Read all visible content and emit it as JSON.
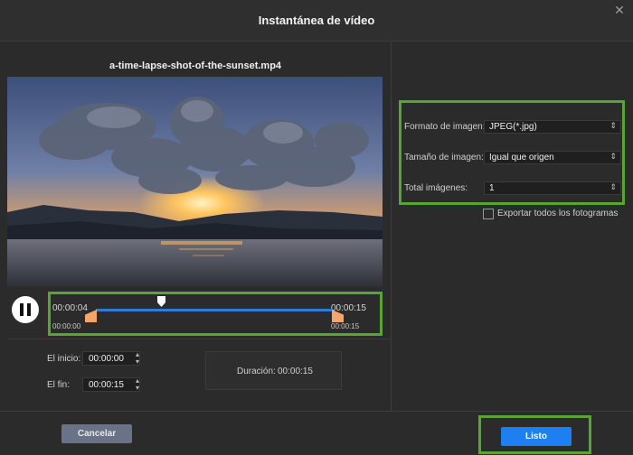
{
  "dialog": {
    "title": "Instantánea de vídeo",
    "close_symbol": "✕"
  },
  "video": {
    "filename": "a-time-lapse-shot-of-the-sunset.mp4",
    "thumbnail_description_icon": "sunset-video-frame"
  },
  "player": {
    "play_state_icon": "pause-icon"
  },
  "timeline": {
    "current_time": "00:00:04",
    "end_time": "00:00:15",
    "range_start_small": "00:00:00",
    "range_end_small": "00:00:15",
    "track_color": "#2f7bd6",
    "handle_color": "#f4a56a"
  },
  "range": {
    "start_label": "El inicio:",
    "start_value": "00:00:00",
    "end_label": "El fin:",
    "end_value": "00:00:15",
    "duration_label": "Duración:",
    "duration_value": "00:00:15"
  },
  "settings": {
    "format_label": "Formato de imagen:",
    "format_value": "JPEG(*.jpg)",
    "size_label": "Tamaño de imagen:",
    "size_value": "Igual que origen",
    "total_label": "Total imágenes:",
    "total_value": "1",
    "export_all_label": "Exportar todos los fotogramas",
    "export_all_checked": false
  },
  "footer": {
    "cancel_label": "Cancelar",
    "ok_label": "Listo"
  },
  "colors": {
    "highlight": "#5aa531",
    "accent": "#1e7ff2",
    "background": "#2b2b2b"
  }
}
